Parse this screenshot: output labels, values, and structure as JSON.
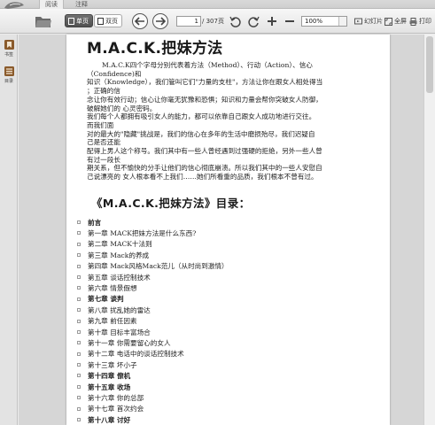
{
  "tabs": [
    {
      "label": "阅读"
    },
    {
      "label": "注释"
    }
  ],
  "toolbar": {
    "single_page_label": "单页",
    "double_page_label": "双页",
    "current_page": "1",
    "total_pages": "/ 307页",
    "zoom": "100%",
    "slideshow_label": "幻灯片",
    "fullscreen_label": "全屏",
    "print_label": "打印"
  },
  "sidebar": {
    "items": [
      {
        "label": "书签"
      },
      {
        "label": "目录"
      }
    ]
  },
  "document": {
    "title": "M.A.C.K.把妹方法",
    "intro_lines": [
      "M.A.C.K四个字母分别代表着方法（Method）、行动（Action）、信心",
      "（Confidence)和",
      "知识（Knowledge），我们管叫它们\"力量的支柱\"，方法让你在跟女人相处得当",
      "；正确的信",
      "念让你有效行动；信心让你毫无犹豫和恐惧；知识和力量会帮你突破女人防御，",
      "破解她们的 心灵密码。",
      "我们每个人都拥有吸引女人的能力，都可以依靠自己跟女人成功地进行交往。",
      "而我们面",
      "对的最大的\"隐藏\"挑战是，我们的信心在多年的生活中磨损殆尽，我们迟疑自",
      "己是否还能",
      "配得上男人这个称号。我们其中有一些人曾经遇到过强硬的拒绝，另外一些人曾",
      "有过一段长",
      "期关系，但不愉快的分手让他们的信心彻底崩溃。所以我们其中的一些人安慰自",
      "己说漂亮的 女人根本看不上我们……她们所看重的品质，我们根本不曾有过。"
    ],
    "toc_heading": "《M.A.C.K.把妹方法》目录：",
    "toc": [
      {
        "text": "前言",
        "bold": true
      },
      {
        "text": "第一章 MACK把妹方法是什么东西?",
        "bold": false
      },
      {
        "text": "第二章 MACK十法则",
        "bold": false
      },
      {
        "text": "第三章 Mack的养成",
        "bold": false
      },
      {
        "text": "第四章 Mack风格Mack范儿（从时尚到激情）",
        "bold": false
      },
      {
        "text": "第五章 谈话控制技术",
        "bold": false
      },
      {
        "text": "第六章 情景假想",
        "bold": false
      },
      {
        "text": "第七章 谈判",
        "bold": true
      },
      {
        "text": "第八章 扰乱她的雷达",
        "bold": false
      },
      {
        "text": "第九章 前任因素",
        "bold": false
      },
      {
        "text": "第十章 目标丰富场合",
        "bold": false
      },
      {
        "text": "第十一章 你需要留心的女人",
        "bold": false
      },
      {
        "text": "第十二章 电话中的谈话控制技术",
        "bold": false
      },
      {
        "text": "第十三章 坏小子",
        "bold": false
      },
      {
        "text": "第十四章 僚机",
        "bold": true
      },
      {
        "text": "第十五章 收场",
        "bold": true
      },
      {
        "text": "第十六章 你的总部",
        "bold": false
      },
      {
        "text": "第十七章 首次约会",
        "bold": false
      },
      {
        "text": "第十八章 讨好",
        "bold": true
      }
    ]
  },
  "colors": {
    "toolbar_bg": "#e9e9e9",
    "page_bg": "#ffffff",
    "doc_area_bg": "#d6d6d6",
    "sidebar_icon": "#8a5a2b"
  },
  "icons": [
    "app-logo-icon",
    "folder-open-icon",
    "back-arrow-icon",
    "forward-arrow-icon",
    "rotate-left-icon",
    "rotate-right-icon",
    "zoom-in-icon",
    "zoom-out-icon",
    "slideshow-icon",
    "fullscreen-icon",
    "print-icon",
    "bookmark-icon",
    "toc-icon"
  ]
}
